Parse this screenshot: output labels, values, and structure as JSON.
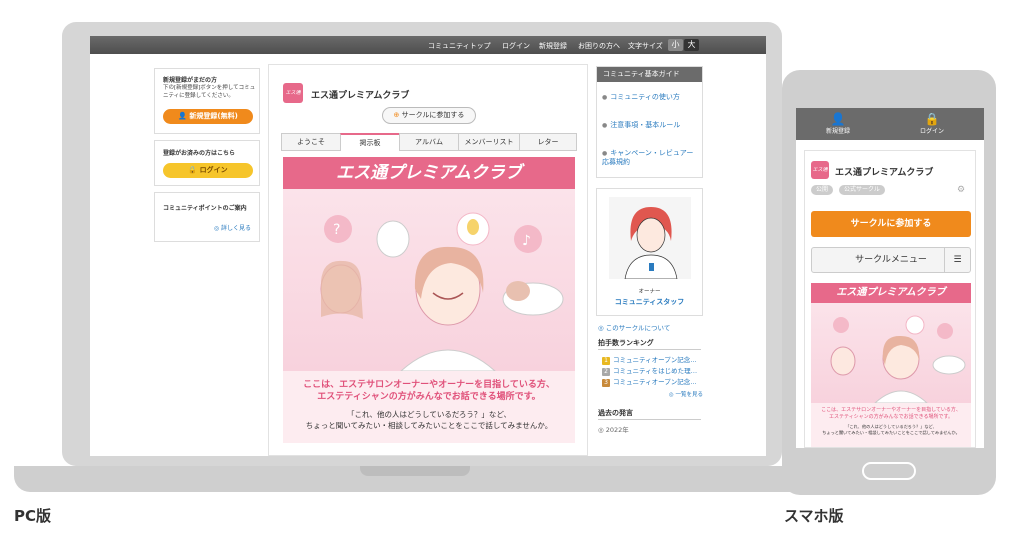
{
  "labels": {
    "pc": "PC版",
    "phone": "スマホ版"
  },
  "pc": {
    "topnav": {
      "items": [
        "コミュニティトップ",
        "ログイン",
        "新規登録",
        "お困りの方へ"
      ],
      "font_size_label": "文字サイズ",
      "size_small": "小",
      "size_large": "大"
    },
    "left": {
      "register_title": "新規登録がまだの方",
      "register_text": "下の[新規登録]ボタンを押してコミュニティに登録してください。",
      "register_button": "新規登録(無料)",
      "login_title": "登録がお済みの方はこちら",
      "login_button": "ログイン",
      "points_title": "コミュニティポイントのご案内",
      "points_link": "詳しく見る"
    },
    "circle": {
      "logo_text": "エス通",
      "name": "エス通プレミアムクラブ",
      "join_button": "サークルに参加する",
      "tabs": [
        "ようこそ",
        "掲示板",
        "アルバム",
        "メンバーリスト",
        "レター"
      ],
      "active_tab": "掲示板",
      "banner_title": "エス通プレミアムクラブ",
      "desc_line1": "ここは、エステサロンオーナーやオーナーを目指している方、",
      "desc_line2": "エステティシャンの方がみんなでお話できる場所です。",
      "sub_line1": "「これ、他の人はどうしているだろう？」など、",
      "sub_line2": "ちょっと聞いてみたい・相談してみたいことをここで話してみませんか。"
    },
    "right": {
      "guide_title": "コミュニティ基本ガイド",
      "guide_links": [
        "コミュニティの使い方",
        "注意事項・基本ルール",
        "キャンペーン・レビュアー応募規約"
      ],
      "owner_role": "オーナー",
      "owner_name": "コミュニティスタッフ",
      "about_link": "このサークルについて",
      "ranking_title": "拍手数ランキング",
      "ranking": [
        "コミュニティオープン記念…",
        "コミュニティをはじめた理…",
        "コミュニティオープン記念…"
      ],
      "ranking_more": "一覧を見る",
      "archive_title": "過去の発言",
      "archive_year": "2022年"
    }
  },
  "phone": {
    "nav_register": "新規登録",
    "nav_login": "ログイン",
    "logo_text": "エス通",
    "name": "エス通プレミアムクラブ",
    "tags": [
      "公開",
      "公式サークル"
    ],
    "join_button": "サークルに参加する",
    "menu_button": "サークルメニュー",
    "banner_title": "エス通プレミアムクラブ",
    "desc_line1": "ここは、エステサロンオーナーやオーナーを目指している方、",
    "desc_line2": "エステティシャンの方がみんなでお話できる場所です。",
    "sub_line1": "「これ、他の人はどうしているだろう？」など、",
    "sub_line2": "ちょっと聞いてみたい・相談してみたいことをここで話してみませんか。"
  },
  "colors": {
    "accent_pink": "#e7698a",
    "button_orange": "#f08a1c",
    "button_yellow": "#f6c52b",
    "link_blue": "#2a7bbf"
  }
}
